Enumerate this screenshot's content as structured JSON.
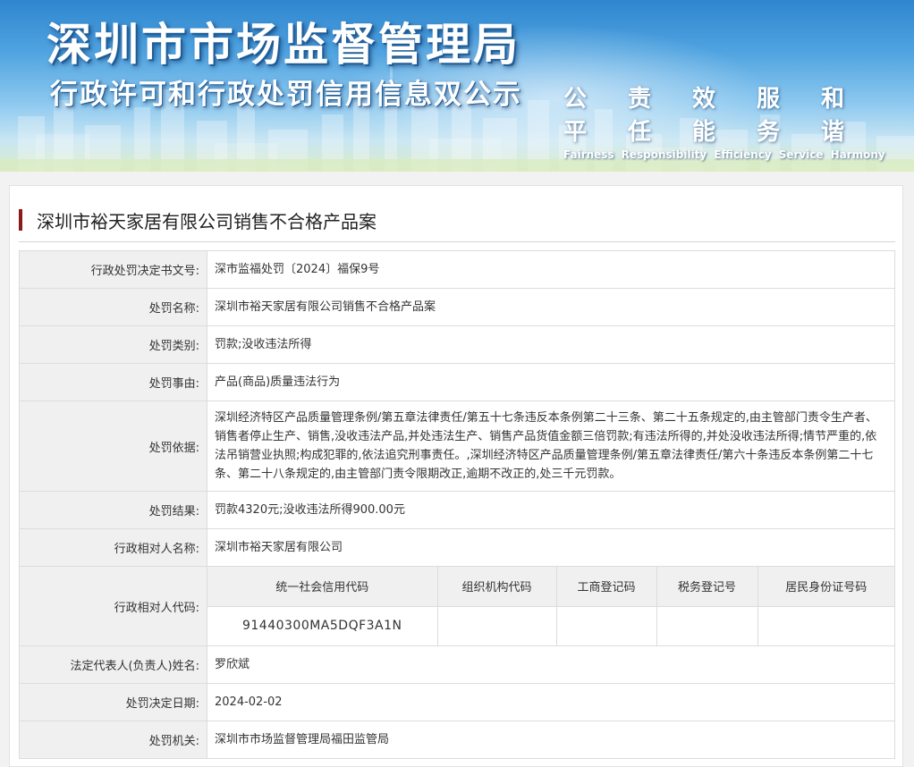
{
  "banner": {
    "title": "深圳市市场监督管理局",
    "subtitle": "行政许可和行政处罚信用信息双公示",
    "slogans_cn": [
      "公平",
      "责任",
      "效能",
      "服务",
      "和谐"
    ],
    "slogans_en": [
      "Fairness",
      "Responsibility",
      "Efficiency",
      "Service",
      "Harmony"
    ]
  },
  "case_title": "深圳市裕天家居有限公司销售不合格产品案",
  "fields": {
    "doc_no": {
      "label": "行政处罚决定书文号:",
      "value": "深市监福处罚〔2024〕福保9号"
    },
    "case_name": {
      "label": "处罚名称:",
      "value": "深圳市裕天家居有限公司销售不合格产品案"
    },
    "category": {
      "label": "处罚类别:",
      "value": "罚款;没收违法所得"
    },
    "reason": {
      "label": "处罚事由:",
      "value": "产品(商品)质量违法行为"
    },
    "basis": {
      "label": "处罚依据:",
      "value": "深圳经济特区产品质量管理条例/第五章法律责任/第五十七条违反本条例第二十三条、第二十五条规定的,由主管部门责令生产者、销售者停止生产、销售,没收违法产品,并处违法生产、销售产品货值金额三倍罚款;有违法所得的,并处没收违法所得;情节严重的,依法吊销营业执照;构成犯罪的,依法追究刑事责任。,深圳经济特区产品质量管理条例/第五章法律责任/第六十条违反本条例第二十七条、第二十八条规定的,由主管部门责令限期改正,逾期不改正的,处三千元罚款。"
    },
    "result": {
      "label": "处罚结果:",
      "value": "罚款4320元;没收违法所得900.00元"
    },
    "party_name": {
      "label": "行政相对人名称:",
      "value": "深圳市裕天家居有限公司"
    },
    "party_code": {
      "label": "行政相对人代码:",
      "headers": [
        "统一社会信用代码",
        "组织机构代码",
        "工商登记码",
        "税务登记号",
        "居民身份证号码"
      ],
      "values": [
        "91440300MA5DQF3A1N",
        "",
        "",
        "",
        ""
      ]
    },
    "legal_rep": {
      "label": "法定代表人(负责人)姓名:",
      "value": "罗欣斌"
    },
    "decision_date": {
      "label": "处罚决定日期:",
      "value": "2024-02-02"
    },
    "authority": {
      "label": "处罚机关:",
      "value": "深圳市市场监督管理局福田监管局"
    }
  }
}
